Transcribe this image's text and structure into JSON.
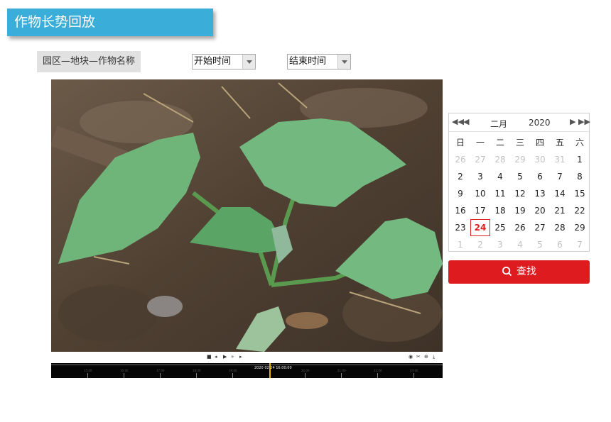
{
  "header": {
    "title": "作物长势回放"
  },
  "filters": {
    "breadcrumb": "园区—地块—作物名称",
    "start_time": "开始时间",
    "end_time": "结束时间"
  },
  "player": {
    "controls_left": [
      "stop-icon",
      "prev-frame-icon",
      "play-icon",
      "fast-forward-icon",
      "next-frame-icon"
    ],
    "controls_right": [
      "snapshot-icon",
      "clip-icon",
      "zoom-icon",
      "download-icon"
    ],
    "timeline_cursor_text": "2020 02 24 16:00:00",
    "timeline_ticks": [
      "15:00",
      "16:00",
      "17:00",
      "18:00",
      "19:00",
      "20:00",
      "21:00",
      "22:00",
      "23:00"
    ]
  },
  "calendar": {
    "month": "二月",
    "year": "2020",
    "weekdays": [
      "日",
      "一",
      "二",
      "三",
      "四",
      "五",
      "六"
    ],
    "weeks": [
      [
        "26",
        "27",
        "28",
        "29",
        "30",
        "31",
        "1"
      ],
      [
        "2",
        "3",
        "4",
        "5",
        "6",
        "7",
        "8"
      ],
      [
        "9",
        "10",
        "11",
        "12",
        "13",
        "14",
        "15"
      ],
      [
        "16",
        "17",
        "18",
        "19",
        "20",
        "21",
        "22"
      ],
      [
        "23",
        "24",
        "25",
        "26",
        "27",
        "28",
        "29"
      ],
      [
        "1",
        "2",
        "3",
        "4",
        "5",
        "6",
        "7"
      ]
    ],
    "selected_day": "24"
  },
  "search_button": {
    "label": "查找"
  },
  "colors": {
    "title_bg": "#3aaed8",
    "accent_red": "#de1b1f"
  }
}
